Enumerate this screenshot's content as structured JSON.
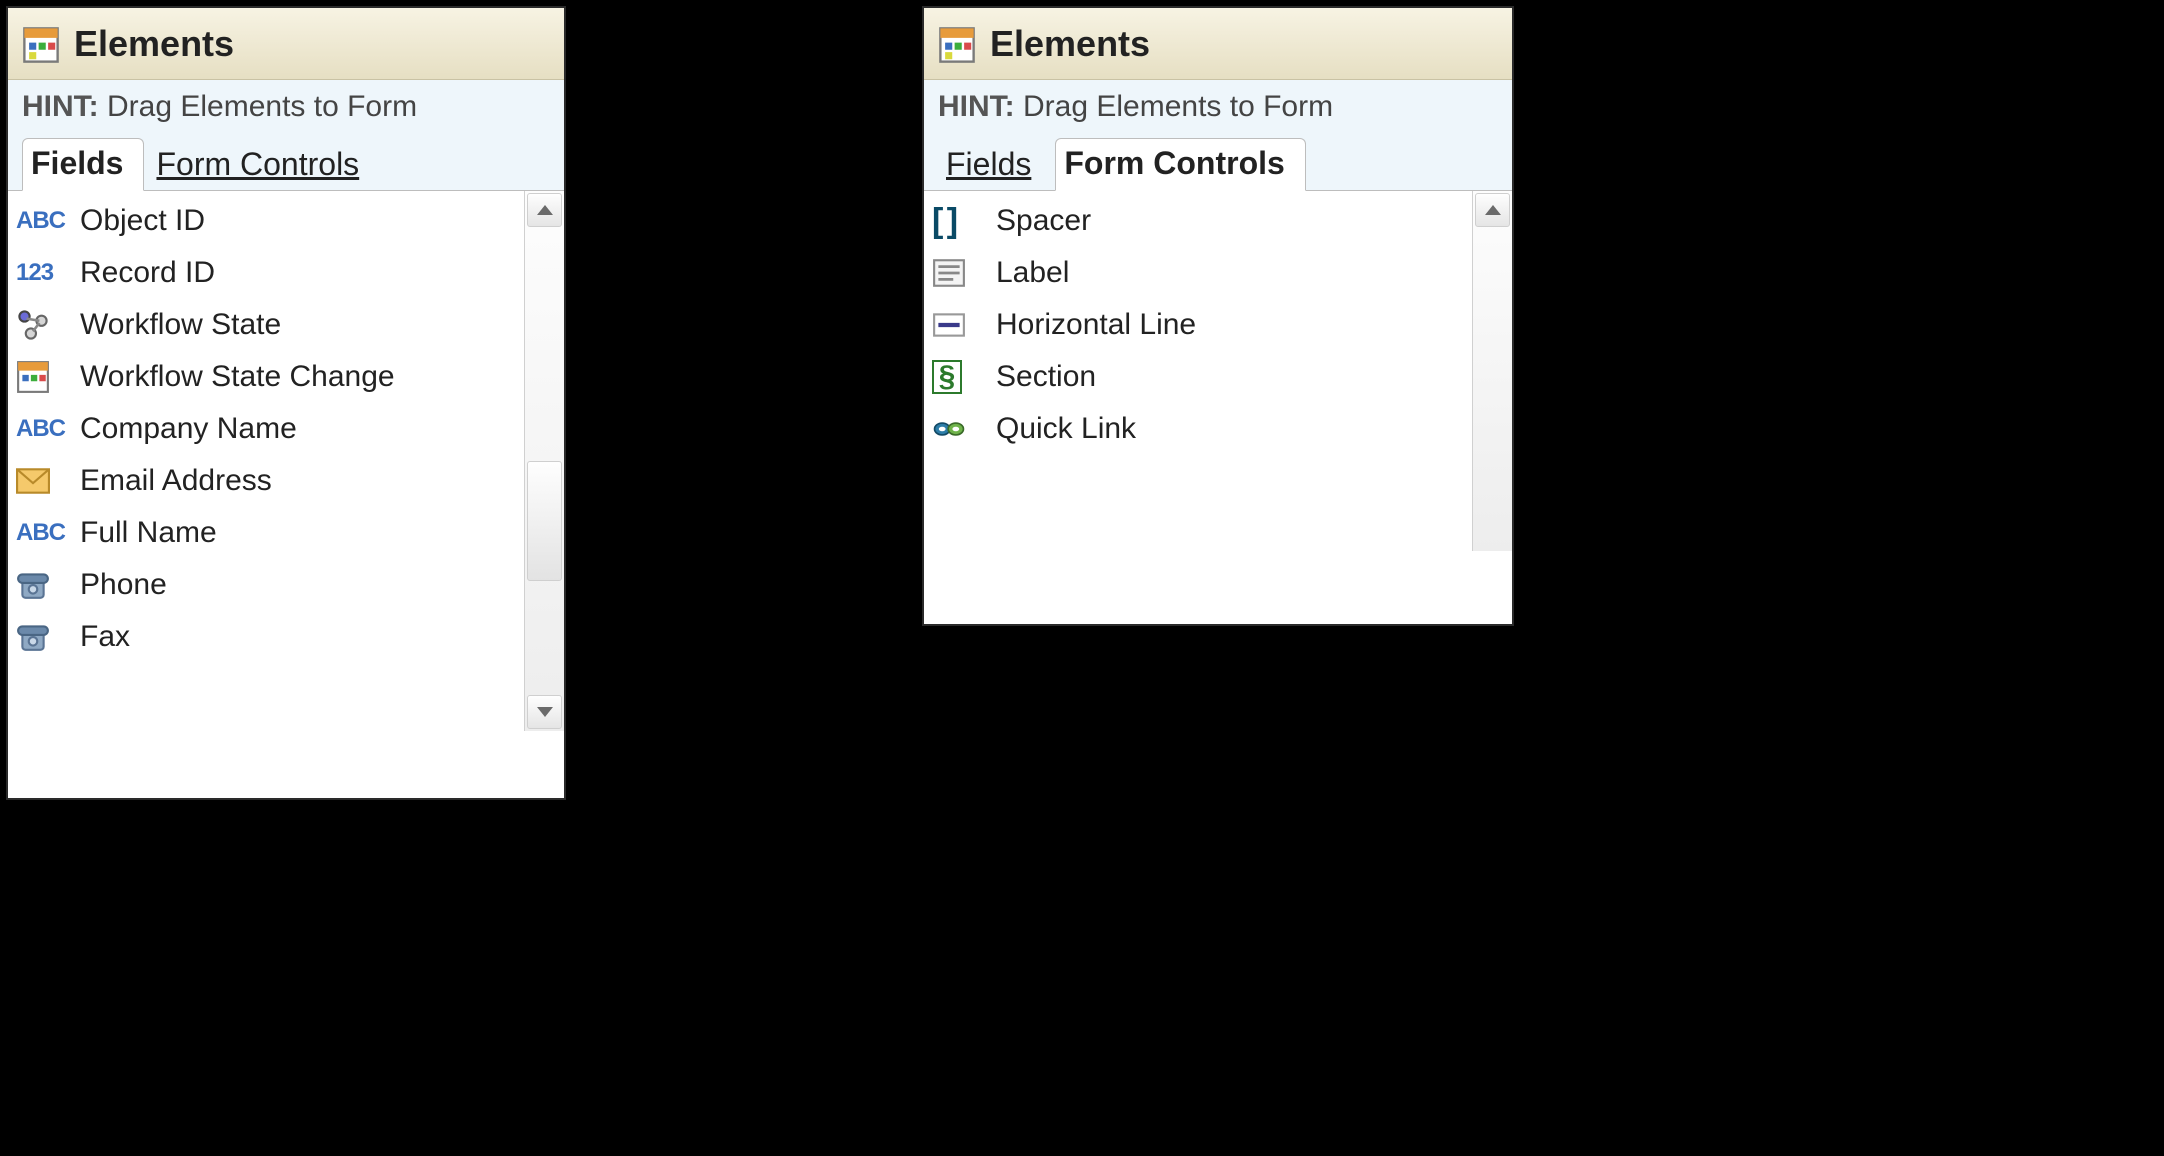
{
  "panels": {
    "left": {
      "title": "Elements",
      "hint_label": "HINT:",
      "hint_text": "Drag Elements to Form",
      "tabs": {
        "fields": "Fields",
        "formControls": "Form Controls"
      },
      "activeTab": "fields",
      "items": [
        {
          "icon": "abc",
          "label": "Object ID"
        },
        {
          "icon": "num",
          "label": "Record ID"
        },
        {
          "icon": "workflow",
          "label": "Workflow State"
        },
        {
          "icon": "calendar",
          "label": "Workflow State Change"
        },
        {
          "icon": "abc",
          "label": "Company Name"
        },
        {
          "icon": "email",
          "label": "Email Address"
        },
        {
          "icon": "abc",
          "label": "Full Name"
        },
        {
          "icon": "phone",
          "label": "Phone"
        },
        {
          "icon": "phone",
          "label": "Fax"
        }
      ]
    },
    "right": {
      "title": "Elements",
      "hint_label": "HINT:",
      "hint_text": "Drag Elements to Form",
      "tabs": {
        "fields": "Fields",
        "formControls": "Form Controls"
      },
      "activeTab": "formControls",
      "items": [
        {
          "icon": "spacer",
          "label": "Spacer"
        },
        {
          "icon": "label",
          "label": "Label"
        },
        {
          "icon": "hline",
          "label": "Horizontal Line"
        },
        {
          "icon": "section",
          "label": "Section"
        },
        {
          "icon": "quicklink",
          "label": "Quick Link"
        }
      ]
    }
  },
  "iconText": {
    "abc": "ABC",
    "num": "123",
    "spacer": "[ ]",
    "section": "§"
  },
  "colors": {
    "headerGradientTop": "#f7f3e3",
    "headerGradientBottom": "#e6dfc3",
    "hintBackground": "#eef6fb",
    "iconBlue": "#3a6fbf",
    "sectionGreen": "#2c7a2c"
  }
}
